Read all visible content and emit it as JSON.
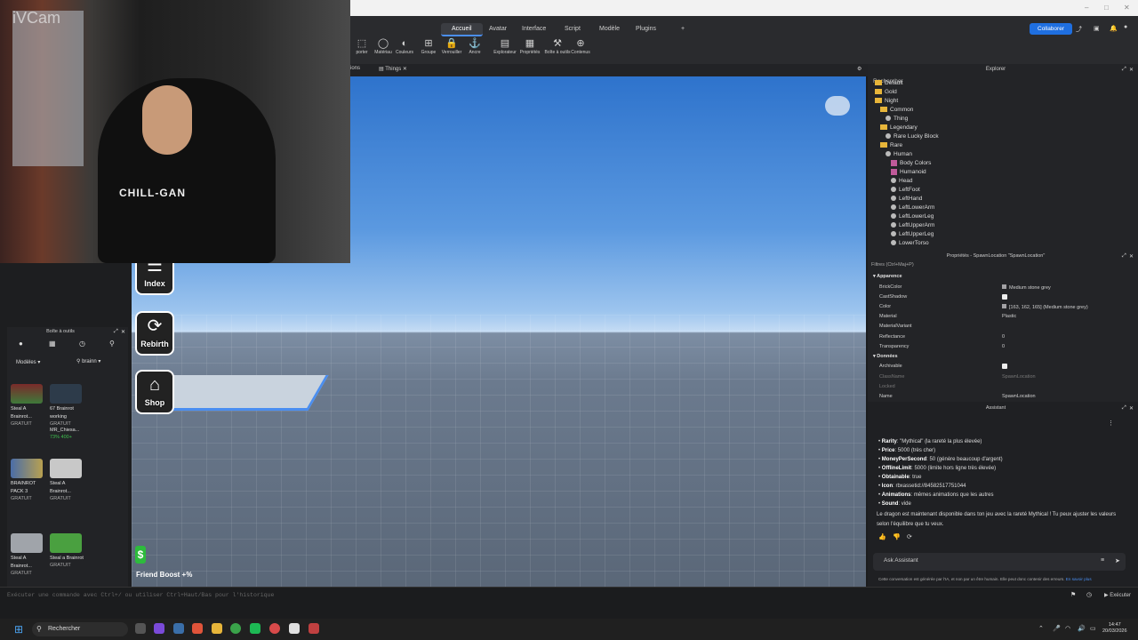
{
  "menu": {
    "tabs": [
      "Accueil",
      "Avatar",
      "Interface",
      "Script",
      "Modèle",
      "Plugins"
    ],
    "active": "Accueil",
    "plus": "+",
    "collaborate": "Collaborer"
  },
  "toolbar": {
    "tools": [
      {
        "icon": "◯",
        "label": "Matériau",
        "name": "material-tool"
      },
      {
        "icon": "◐",
        "label": "Couleurs",
        "name": "colors-tool"
      },
      {
        "icon": "⊞",
        "label": "Groupe",
        "name": "group-tool"
      },
      {
        "icon": "🔒",
        "label": "Verrouiller",
        "name": "lock-tool"
      },
      {
        "icon": "⚓",
        "label": "Ancre",
        "name": "anchor-tool"
      },
      {
        "icon": "▤",
        "label": "Explorateur",
        "name": "explorer-tool"
      },
      {
        "icon": "▦",
        "label": "Propriétés",
        "name": "properties-tool"
      },
      {
        "icon": "⚒",
        "label": "Boîte à outils",
        "name": "toolbox-tool"
      },
      {
        "icon": "⊕",
        "label": "Contenus",
        "name": "contents-tool"
      }
    ],
    "partial_left": "porter"
  },
  "doctabs": {
    "left": "ions",
    "active": "Things"
  },
  "webcam": {
    "label": "iVCam",
    "shirt": "CHILL-GAN"
  },
  "hud": {
    "index": "Index",
    "rebirth": "Rebirth",
    "shop": "Shop",
    "friend_boost": "Friend Boost +%",
    "dollar": "$"
  },
  "toolbox": {
    "title": "Boîte à outils",
    "category": "Modèles",
    "search": "brainn",
    "assets": [
      {
        "name": "Steal A Brainrot...",
        "price": "GRATUIT",
        "extra": ""
      },
      {
        "name": "67 Brainrot working",
        "price": "GRATUIT",
        "extra": "MR_Chiesa..."
      },
      {
        "name": "BRAINROT PACK 3",
        "price": "GRATUIT",
        "extra": ""
      },
      {
        "name": "Steal A Brainrot...",
        "price": "GRATUIT",
        "extra": ""
      },
      {
        "name": "Steal A Brainrot...",
        "price": "GRATUIT",
        "extra": ""
      },
      {
        "name": "Steal a Brainrot",
        "price": "GRATUIT",
        "extra": ""
      }
    ],
    "rating": "73% 400+"
  },
  "explorer": {
    "title": "Explorer",
    "search_placeholder": "Rechercher",
    "items": [
      {
        "t": "Default",
        "d": 3,
        "k": "f"
      },
      {
        "t": "Gold",
        "d": 3,
        "k": "f"
      },
      {
        "t": "Night",
        "d": 3,
        "k": "f"
      },
      {
        "t": "Common",
        "d": 4,
        "k": "f"
      },
      {
        "t": "Thing",
        "d": 5,
        "k": "p"
      },
      {
        "t": "Legendary",
        "d": 4,
        "k": "f"
      },
      {
        "t": "Rare Lucky Block",
        "d": 5,
        "k": "p"
      },
      {
        "t": "Rare",
        "d": 4,
        "k": "f"
      },
      {
        "t": "Human",
        "d": 5,
        "k": "p"
      },
      {
        "t": "Body Colors",
        "d": 6,
        "k": "c"
      },
      {
        "t": "Humanoid",
        "d": 6,
        "k": "c"
      },
      {
        "t": "Head",
        "d": 6,
        "k": "p"
      },
      {
        "t": "LeftFoot",
        "d": 6,
        "k": "p"
      },
      {
        "t": "LeftHand",
        "d": 6,
        "k": "p"
      },
      {
        "t": "LeftLowerArm",
        "d": 6,
        "k": "p"
      },
      {
        "t": "LeftLowerLeg",
        "d": 6,
        "k": "p"
      },
      {
        "t": "LeftUpperArm",
        "d": 6,
        "k": "p"
      },
      {
        "t": "LeftUpperLeg",
        "d": 6,
        "k": "p"
      },
      {
        "t": "LowerTorso",
        "d": 6,
        "k": "p"
      }
    ]
  },
  "properties": {
    "title": "Propriétés - SpawnLocation \"SpawnLocation\"",
    "filter": "Filtres (Ctrl+Maj+P)",
    "sections": [
      {
        "name": "Apparence",
        "rows": [
          {
            "k": "BrickColor",
            "v": "Medium stone grey",
            "sw": true
          },
          {
            "k": "CastShadow",
            "v": "",
            "chk": true
          },
          {
            "k": "Color",
            "v": "[163, 162, 165] (Medium stone grey)",
            "sw": true
          },
          {
            "k": "Material",
            "v": "Plastic"
          },
          {
            "k": "MaterialVariant",
            "v": ""
          },
          {
            "k": "Reflectance",
            "v": "0"
          },
          {
            "k": "Transparency",
            "v": "0"
          }
        ]
      },
      {
        "name": "Données",
        "rows": [
          {
            "k": "Archivable",
            "v": "",
            "chk": true
          },
          {
            "k": "ClassName",
            "v": "SpawnLocation",
            "dim": true
          },
          {
            "k": "Locked",
            "v": "",
            "dim": true
          },
          {
            "k": "Name",
            "v": "SpawnLocation"
          }
        ]
      }
    ]
  },
  "assistant": {
    "title": "Assistant",
    "bullets": [
      {
        "k": "Rarity",
        "v": ": \"Mythical\" (la rareté la plus élevée)"
      },
      {
        "k": "Price",
        "v": ": 5000 (très cher)"
      },
      {
        "k": "MoneyPerSecond",
        "v": ": 50 (génère beaucoup d'argent)"
      },
      {
        "k": "OfflineLimit",
        "v": ": 5000 (limite hors ligne très élevée)"
      },
      {
        "k": "Obtainable",
        "v": ": true"
      },
      {
        "k": "Icon",
        "v": ": rbxassetid://84582517751044"
      },
      {
        "k": "Animations",
        "v": ": mêmes animations que les autres"
      },
      {
        "k": "Sound",
        "v": ": vide"
      }
    ],
    "para1": "Le dragon est maintenant disponible dans ton jeu avec la rareté Mythical ! Tu peux ajuster les valeurs",
    "para2": "selon l'équilibre que tu veux.",
    "input_placeholder": "Ask Assistant",
    "footer": "Cette conversation est générée par l'IA, et non par un être humain. Elle peut donc contenir des erreurs.",
    "footer_link": "En savoir plus"
  },
  "cmdbar": {
    "text": "Exécuter une commande avec Ctrl+/ ou utiliser Ctrl+Haut/Bas pour l'historique",
    "run": "Exécuter"
  },
  "taskbar": {
    "search": "Rechercher",
    "time": "14:47",
    "date": "20/03/2026"
  },
  "colors": {
    "accent": "#1f6fe0",
    "sky": "#2e73cc",
    "folder": "#e7b53a"
  }
}
